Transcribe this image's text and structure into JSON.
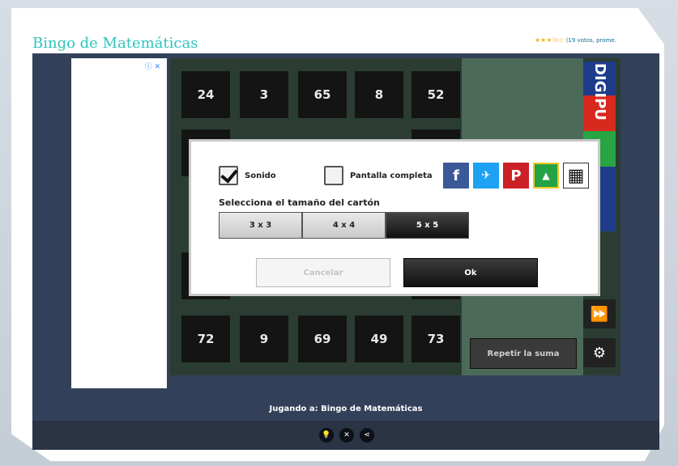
{
  "page": {
    "title": "Bingo de Matemáticas",
    "rating": {
      "stars": "★★★½☆",
      "votes_text": "(19 votos, prome."
    }
  },
  "ad": {
    "icons": "ⓘ ✕"
  },
  "board": {
    "top_row": [
      "24",
      "3",
      "65",
      "8",
      "52"
    ],
    "bottom_row": [
      "72",
      "9",
      "69",
      "49",
      "73"
    ]
  },
  "brand": {
    "letters": "DIGIPU"
  },
  "controls": {
    "repeat_label": "Repetir la suma",
    "next_icon": "fast-forward-icon",
    "settings_icon": "gear-icon"
  },
  "dialog": {
    "sound_label": "Sonido",
    "sound_checked": true,
    "fullscreen_label": "Pantalla completa",
    "fullscreen_checked": false,
    "size_heading": "Selecciona el tamaño del cartón",
    "sizes": [
      "3 x 3",
      "4 x 4",
      "5 x 5"
    ],
    "selected_size": "5 x 5",
    "cancel_label": "Cancelar",
    "ok_label": "Ok",
    "share": [
      {
        "name": "facebook-icon",
        "glyph": "f",
        "color": "#3b5998"
      },
      {
        "name": "twitter-icon",
        "glyph": "🐦",
        "color": "#1da1f2"
      },
      {
        "name": "pinterest-icon",
        "glyph": "P",
        "color": "#cb2027"
      },
      {
        "name": "google-classroom-icon",
        "glyph": "▲",
        "color": "#25a244"
      },
      {
        "name": "qr-code-icon",
        "glyph": "▦",
        "color": "#ffffff"
      }
    ]
  },
  "footer": {
    "playing_text": "Jugando a: Bingo de Matemáticas",
    "buttons": [
      "lightbulb-icon",
      "fullscreen-icon",
      "share-icon"
    ]
  }
}
